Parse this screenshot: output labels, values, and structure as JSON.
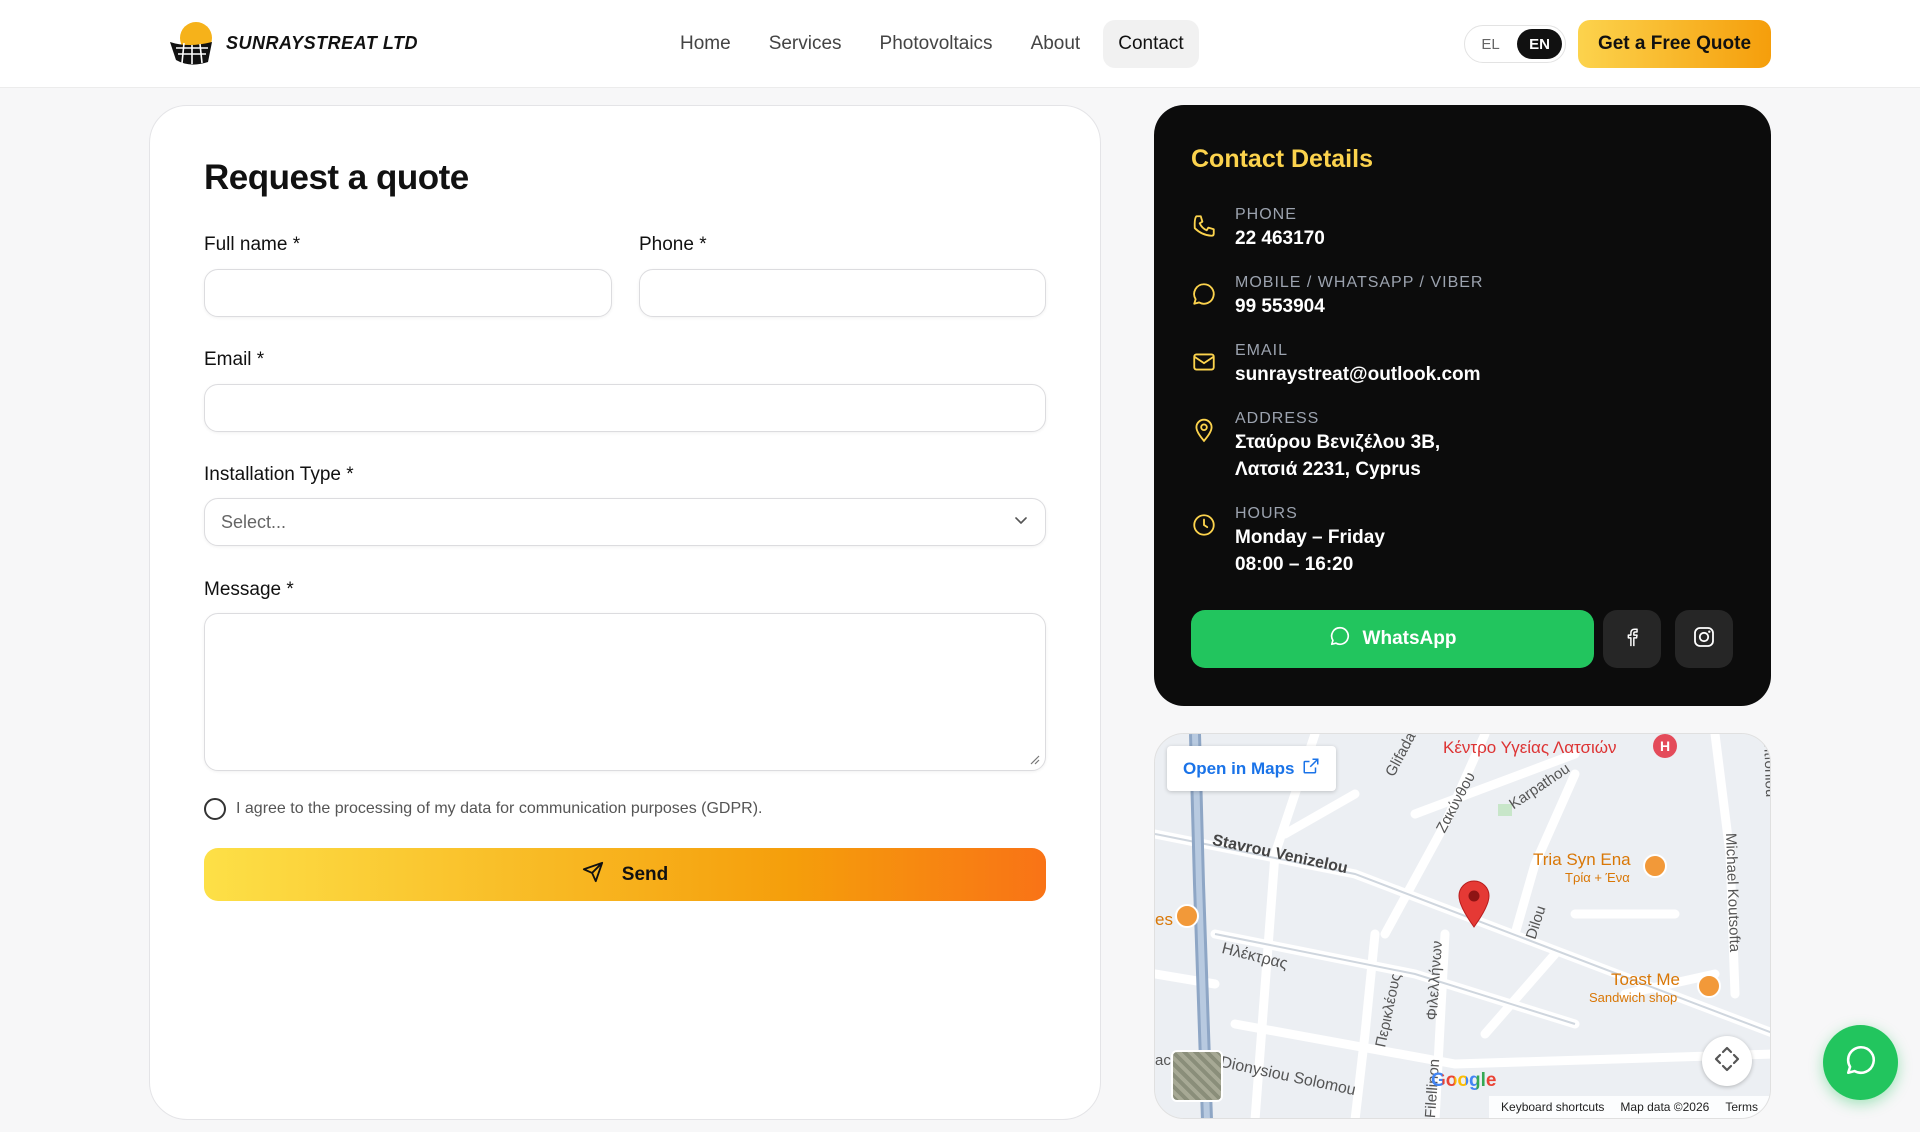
{
  "brand": {
    "name": "SUNRAYSTREAT LTD"
  },
  "nav": {
    "items": [
      {
        "label": "Home"
      },
      {
        "label": "Services"
      },
      {
        "label": "Photovoltaics"
      },
      {
        "label": "About"
      },
      {
        "label": "Contact",
        "active": true
      }
    ]
  },
  "lang": {
    "options": [
      "EL",
      "EN"
    ],
    "selected": "EN"
  },
  "header": {
    "cta_label": "Get a Free Quote"
  },
  "form": {
    "title": "Request a quote",
    "full_name": {
      "label": "Full name *",
      "value": ""
    },
    "phone": {
      "label": "Phone *",
      "value": ""
    },
    "email": {
      "label": "Email *",
      "value": ""
    },
    "installation_type": {
      "label": "Installation Type *",
      "selected": "Select..."
    },
    "message": {
      "label": "Message *",
      "value": ""
    },
    "gdpr_label": "I agree to the processing of my data for communication purposes (GDPR).",
    "gdpr_checked": false,
    "send_label": "Send"
  },
  "contact": {
    "title": "Contact Details",
    "phone": {
      "label": "PHONE",
      "value": "22 463170"
    },
    "mobile": {
      "label": "MOBILE / WHATSAPP / VIBER",
      "value": "99 553904"
    },
    "email": {
      "label": "EMAIL",
      "value": "sunraystreat@outlook.com"
    },
    "address": {
      "label": "ADDRESS",
      "line1": "Σταύρου Βενιζέλου 3Β,",
      "line2": "Λατσιά 2231, Cyprus"
    },
    "hours": {
      "label": "HOURS",
      "line1": "Monday – Friday",
      "line2": "08:00 – 16:20"
    },
    "whatsapp_label": "WhatsApp"
  },
  "map": {
    "open_label": "Open in Maps",
    "streets": [
      "Stavrou Venizelou",
      "Ηλέκτρας",
      "Περικλέους",
      "Φιλελλήνων",
      "Filellinon",
      "Dionysiou Solomou",
      "Zακύνθου",
      "Karpathou",
      "Dilou",
      "Michael Koutsofta",
      "Glifada",
      "ntfoniou"
    ],
    "poi": {
      "health": "Κέντρο Υγείας Λατσιών",
      "tria_name": "Tria Syn Ena",
      "tria_sub": "Τρία + Ένα",
      "toast_name": "Toast Me",
      "toast_sub": "Sandwich shop",
      "edge": "es",
      "edge2": "ac"
    },
    "google": "Google",
    "footer": {
      "shortcuts": "Keyboard shortcuts",
      "data": "Map data ©2026",
      "terms": "Terms"
    }
  },
  "colors": {
    "accent": "#fcd34d",
    "accent_dark": "#f59e0b",
    "whatsapp": "#22c55e",
    "card_dark": "#0c0c0c"
  }
}
